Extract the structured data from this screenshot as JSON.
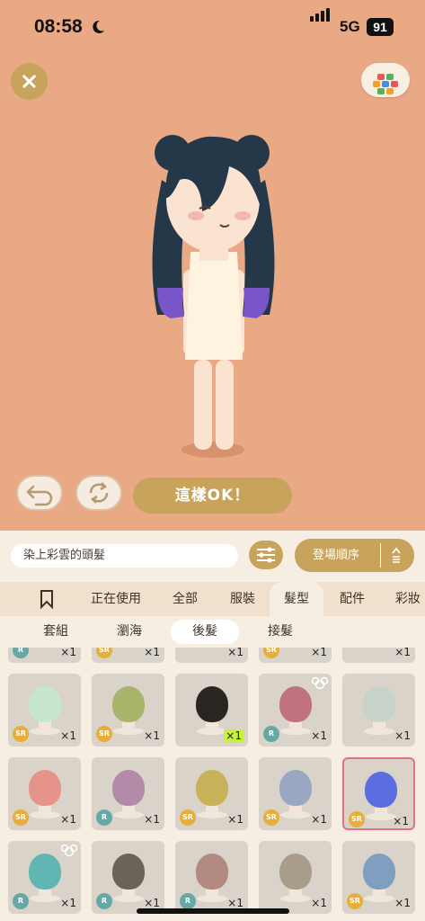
{
  "status_bar": {
    "time": "08:58",
    "network": "5G",
    "battery": "91"
  },
  "preview": {
    "confirm_label": "這樣OK！"
  },
  "toolbar": {
    "search_value": "染上彩雲的頭髮",
    "sort_label": "登場順序"
  },
  "category_tabs": [
    {
      "label": "正在使用"
    },
    {
      "label": "全部"
    },
    {
      "label": "服裝"
    },
    {
      "label": "髮型",
      "active": true
    },
    {
      "label": "配件"
    },
    {
      "label": "彩妝"
    }
  ],
  "hair_subtabs": [
    {
      "label": "套組"
    },
    {
      "label": "瀏海"
    },
    {
      "label": "後髮",
      "active": true
    },
    {
      "label": "接髮"
    }
  ],
  "items": [
    {
      "rarity": "R",
      "count": "×1"
    },
    {
      "rarity": "SR",
      "count": "×1"
    },
    {
      "rarity": "",
      "count": "×1"
    },
    {
      "rarity": "SR",
      "count": "×1"
    },
    {
      "rarity": "",
      "count": "×1"
    },
    {
      "rarity": "SR",
      "count": "×1",
      "color": "#c7e6cf"
    },
    {
      "rarity": "SR",
      "count": "×1",
      "color": "#a7b56a"
    },
    {
      "rarity": "",
      "count": "×1",
      "color": "#2b2522",
      "highlight": true
    },
    {
      "rarity": "R",
      "count": "×1",
      "color": "#c0727f",
      "ears": true
    },
    {
      "rarity": "",
      "count": "×1",
      "color": "#c7d3c8"
    },
    {
      "rarity": "SR",
      "count": "×1",
      "color": "#e6938a"
    },
    {
      "rarity": "R",
      "count": "×1",
      "color": "#b38aa8"
    },
    {
      "rarity": "SR",
      "count": "×1",
      "color": "#c9b159"
    },
    {
      "rarity": "SR",
      "count": "×1",
      "color": "#9aa7c3"
    },
    {
      "rarity": "SR",
      "count": "×1",
      "color": "#5a6ee0",
      "selected": true
    },
    {
      "rarity": "R",
      "count": "×1",
      "color": "#5fb6b3",
      "ears": true
    },
    {
      "rarity": "R",
      "count": "×1",
      "color": "#6b6357"
    },
    {
      "rarity": "R",
      "count": "×1",
      "color": "#b28a82"
    },
    {
      "rarity": "",
      "count": "×1",
      "color": "#a89d8a"
    },
    {
      "rarity": "SR",
      "count": "×1",
      "color": "#7f9fc0"
    }
  ],
  "colors": {
    "background": "#eaa985",
    "accent_gold": "#c7a35c",
    "panel": "#f6ede3"
  }
}
